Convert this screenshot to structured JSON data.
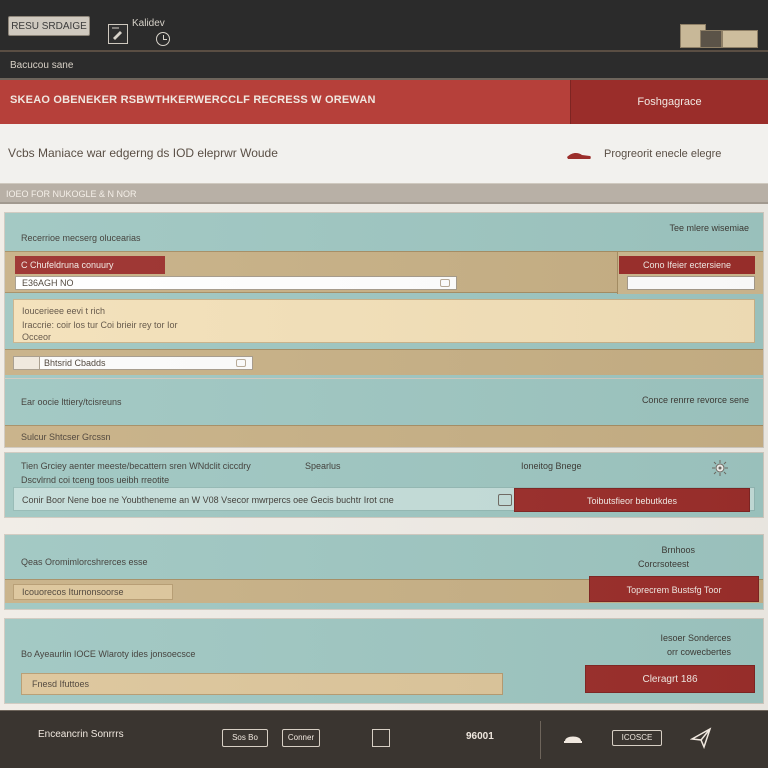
{
  "app": {
    "top_button_label": "RESU SRDAIGE",
    "top_title": "Kalidev",
    "breadcrumb": "Bacucou sane"
  },
  "header": {
    "title": "SKEAO OBENEKER RSBWTHKERWERCCLF RECRESS W OREWAN",
    "action_label": "Foshgagrace",
    "description": "Vcbs Maniace war edgerng ds IOD eleprwr Woude",
    "right_text": "Progreorit enecle elegre"
  },
  "section": {
    "title": "IOEO FOR NUKOGLE & N NOR"
  },
  "panels": {
    "p1": {
      "top_label": "Recerrioe mecserg olucearias",
      "top_right": "Tee mlere wisemiae",
      "red_label": "C Chufeldruna conuury",
      "input_value": "E36AGH NO",
      "right_button": "Cono Ifeier ectersiene",
      "mid_line1": "Ioucerieee eevi t rich",
      "mid_line2": "Iraccrie: coir los tur Coi brieir rey tor Ior",
      "mid_line3": "Occeor",
      "bottom_field_text": "Bhtsrid Cbadds"
    },
    "p2": {
      "title": "Ear oocie lttiery/tcisreuns",
      "right_text": "Conce renrre revorce sene",
      "tan_text": "Sulcur Shtcser Grcssn"
    },
    "p3": {
      "line1": "Tien Grciey aenter meeste/becattern sren WNdclit ciccdry",
      "mid_text": "Spearlus",
      "right_text": "Ioneitog Bnege",
      "line2": "Dscvlrnd coi tceng toos ueibh rreotite",
      "row_text": "Conir Boor Nene boe ne Youbtheneme an W V08 Vsecor mwrpercs oee Gecis buchtr Irot cne",
      "row_button": "Toibutsfieor bebutkdes"
    },
    "p4": {
      "title": "Qeas Oromimlorcshrerces esse",
      "right1": "Brnhoos",
      "right2": "Corcrsoteest",
      "inner_text": "Icouorecos Iturnonsoorse",
      "button": "Toprecrem Bustsfg Toor"
    },
    "p5": {
      "title": "Bo Ayeaurlin IOCE Wlaroty ides jonsoecsce",
      "right1": "Iesoer Sonderces",
      "right2": "orr cowecbertes",
      "field_text": "Fnesd Ifuttoes",
      "button": "Cleragrt 186"
    }
  },
  "footer": {
    "left_label": "Enceancrin Sonrrrs",
    "btn1": "Sos Bo",
    "btn2": "Conner",
    "count": "96001",
    "btn3": "ICOSCE"
  },
  "colors": {
    "red": "#9b2e2b",
    "teal": "#9ec6c1",
    "tan": "#c7b085",
    "dark": "#2b2b2b"
  },
  "icons": {
    "top_left": "square-pen-icon",
    "clock": "clock-icon",
    "packages": "package-icon",
    "shoe": "shoe-icon",
    "gear": "gear-icon",
    "bell": "bell-icon",
    "plane": "plane-icon"
  }
}
